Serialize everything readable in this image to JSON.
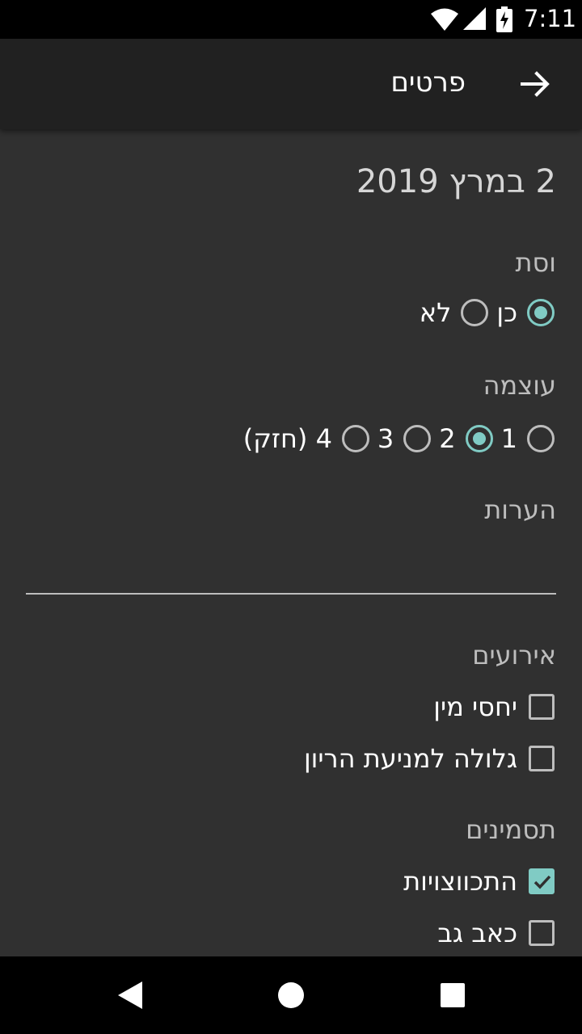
{
  "status_bar": {
    "time": "7:11",
    "icons": [
      "wifi-icon",
      "signal-icon",
      "battery-charging-icon"
    ]
  },
  "app_bar": {
    "title": "פרטים",
    "back_icon": "arrow-forward-icon"
  },
  "date": "2 במרץ 2019",
  "period": {
    "label": "וסת",
    "options": [
      {
        "label": "כן",
        "checked": true
      },
      {
        "label": "לא",
        "checked": false
      }
    ]
  },
  "intensity": {
    "label": "עוצמה",
    "options": [
      {
        "label": "1",
        "checked": false
      },
      {
        "label": "2",
        "checked": true
      },
      {
        "label": "3",
        "checked": false
      },
      {
        "label": "4 (חזק)",
        "checked": false
      }
    ]
  },
  "notes": {
    "label": "הערות",
    "value": ""
  },
  "events": {
    "label": "אירועים",
    "items": [
      {
        "label": "יחסי מין",
        "checked": false
      },
      {
        "label": "גלולה למניעת הריון",
        "checked": false
      }
    ]
  },
  "symptoms": {
    "label": "תסמינים",
    "items": [
      {
        "label": "התכווצויות",
        "checked": true
      },
      {
        "label": "כאב גב",
        "checked": false
      }
    ]
  },
  "nav_bar": {
    "icons": [
      "nav-back-icon",
      "nav-home-icon",
      "nav-recents-icon"
    ]
  },
  "colors": {
    "accent": "#80cbc4",
    "background": "#303030",
    "app_bar": "#212121"
  }
}
